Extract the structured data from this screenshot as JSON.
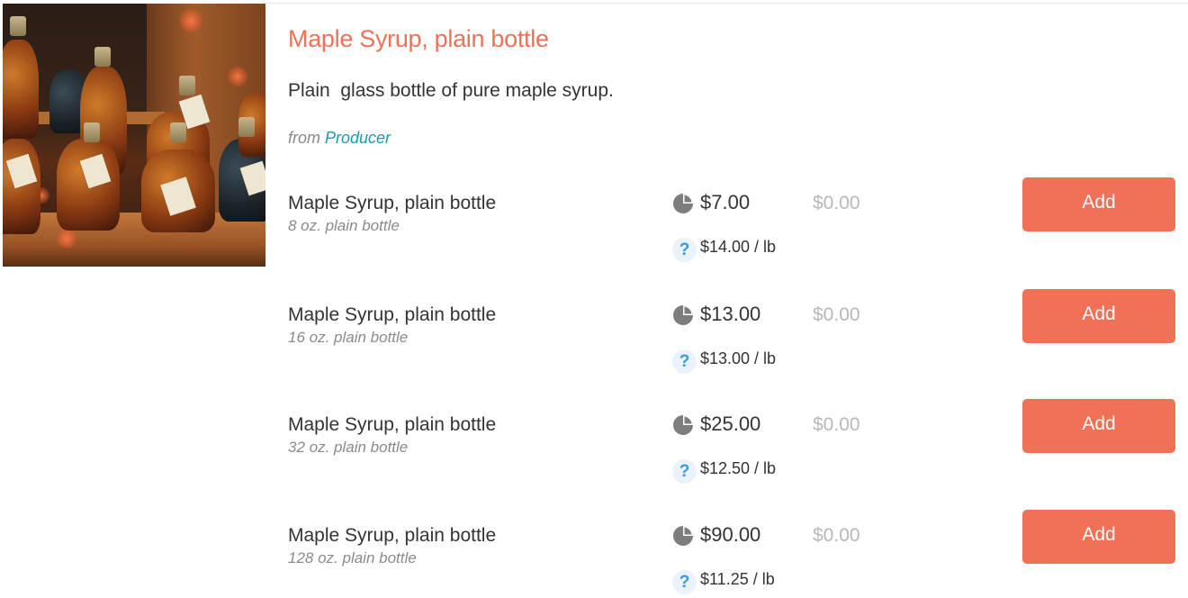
{
  "product": {
    "title": "Maple Syrup, plain bottle",
    "description": "Plain  glass bottle of pure maple syrup.",
    "from_label": "from",
    "producer_link": "Producer"
  },
  "colors": {
    "accent": "#f07155",
    "link": "#1a9ab0",
    "muted": "#8a8a8a",
    "help_icon": "#3a9ae0"
  },
  "icons": {
    "price": "pie-chart-icon",
    "unit_price": "question-icon"
  },
  "variants": [
    {
      "name": "Maple Syrup, plain bottle",
      "size": "8 oz. plain bottle",
      "price": "$7.00",
      "subtotal": "$0.00",
      "unit_price": "$14.00 / lb",
      "help": "?",
      "add_label": "Add"
    },
    {
      "name": "Maple Syrup, plain bottle",
      "size": "16 oz. plain bottle",
      "price": "$13.00",
      "subtotal": "$0.00",
      "unit_price": "$13.00 / lb",
      "help": "?",
      "add_label": "Add"
    },
    {
      "name": "Maple Syrup, plain bottle",
      "size": "32 oz. plain bottle",
      "price": "$25.00",
      "subtotal": "$0.00",
      "unit_price": "$12.50 / lb",
      "help": "?",
      "add_label": "Add"
    },
    {
      "name": "Maple Syrup, plain bottle",
      "size": "128 oz. plain bottle",
      "price": "$90.00",
      "subtotal": "$0.00",
      "unit_price": "$11.25 / lb",
      "help": "?",
      "add_label": "Add"
    }
  ]
}
